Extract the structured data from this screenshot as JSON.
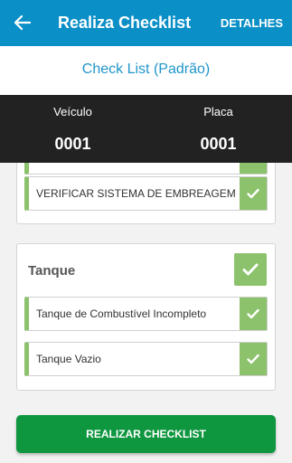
{
  "appbar": {
    "title": "Realiza Checklist",
    "details_label": "DETALHES"
  },
  "subheader": {
    "checklist_name": "Check List (Padrão)"
  },
  "vehicle_info": {
    "vehicle_label": "Veículo",
    "vehicle_value": "0001",
    "plate_label": "Placa",
    "plate_value": "0001"
  },
  "previous_section": {
    "items": [
      {
        "label": ""
      },
      {
        "label": "VERIFICAR SISTEMA DE EMBREAGEM"
      }
    ]
  },
  "tank_section": {
    "title": "Tanque",
    "items": [
      {
        "label": "Tanque de Combustível Incompleto"
      },
      {
        "label": "Tanque Vazio"
      }
    ]
  },
  "action": {
    "submit_label": "REALIZAR CHECKLIST"
  },
  "colors": {
    "appbar": "#0a8fc6",
    "check_green": "#8bc26b",
    "button_green": "#0f973f",
    "info_bar": "#222222"
  }
}
